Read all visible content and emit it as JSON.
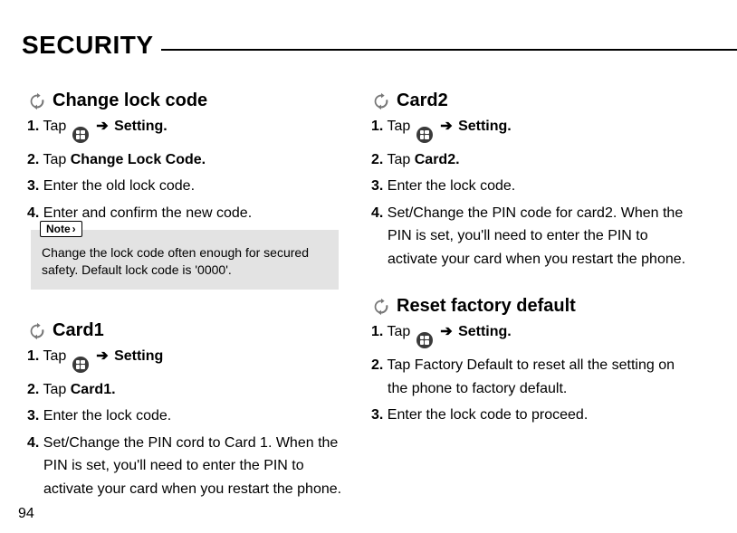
{
  "page": {
    "title": "SECURITY",
    "number": "94"
  },
  "arrow": "➔",
  "sections": {
    "change_lock": {
      "title": "Change lock code",
      "s1_prefix": "1.",
      "s1_a": "Tap",
      "s1_b": "Setting.",
      "s2_prefix": "2.",
      "s2_a": "Tap",
      "s2_b": "Change Lock Code.",
      "s3_prefix": "3.",
      "s3_a": "Enter the old lock code.",
      "s4_prefix": "4.",
      "s4_a": "Enter and confirm the new code.",
      "note_label": "Note",
      "note_text": "Change the lock code often enough for secured safety. Default lock code is '0000'."
    },
    "card1": {
      "title": "Card1",
      "s1_prefix": "1.",
      "s1_a": "Tap",
      "s1_b": "Setting",
      "s2_prefix": "2.",
      "s2_a": "Tap",
      "s2_b": "Card1.",
      "s3_prefix": "3.",
      "s3_a": "Enter the lock code.",
      "s4_prefix": "4.",
      "s4_a": "Set/Change the PIN cord to Card 1. When the",
      "s4_b": "PIN is set, you'll need to enter the PIN to",
      "s4_c": "activate your card when you restart the phone."
    },
    "card2": {
      "title": "Card2",
      "s1_prefix": "1.",
      "s1_a": "Tap",
      "s1_b": "Setting.",
      "s2_prefix": "2.",
      "s2_a": "Tap",
      "s2_b": "Card2.",
      "s3_prefix": "3.",
      "s3_a": "Enter the lock code.",
      "s4_prefix": "4.",
      "s4_a": "Set/Change the PIN code for card2. When the",
      "s4_b": "PIN is set, you'll need to enter the PIN to",
      "s4_c": "activate your card when you restart the phone."
    },
    "reset": {
      "title": "Reset factory default",
      "s1_prefix": "1.",
      "s1_a": "Tap",
      "s1_b": "Setting.",
      "s2_prefix": "2.",
      "s2_a": "Tap Factory Default to reset all the setting on",
      "s2_b": "the phone to factory default.",
      "s3_prefix": "3.",
      "s3_a": "Enter the lock code to proceed."
    }
  }
}
